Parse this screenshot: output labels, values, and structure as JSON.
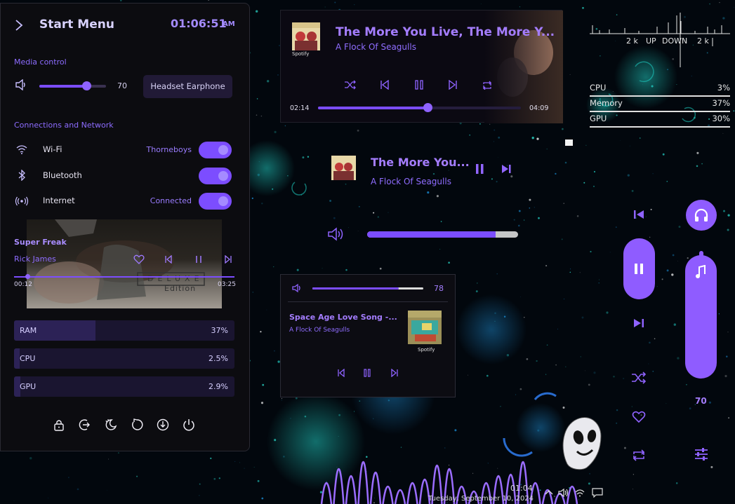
{
  "start_menu": {
    "title": "Start Menu",
    "time": "01:06:51",
    "ampm": "AM",
    "media_section": "Media control",
    "volume": "70",
    "audio_device": "Headset Earphone",
    "network_section": "Connections and Network",
    "wifi_label": "Wi-Fi",
    "wifi_value": "Thorneboys",
    "bluetooth_label": "Bluetooth",
    "internet_label": "Internet",
    "internet_value": "Connected",
    "track_title": "Super Freak",
    "track_artist": "Rick James",
    "album_label_top": "DELUXE",
    "album_label_bottom": "Edition",
    "elapsed": "00:12",
    "duration": "03:25",
    "progress": 0.06,
    "ram_label": "RAM",
    "ram_value": "37%",
    "ram_fraction": 0.37,
    "cpu_label": "CPU",
    "cpu_value": "2.5%",
    "cpu_fraction": 0.025,
    "gpu_label": "GPU",
    "gpu_value": "2.9%",
    "gpu_fraction": 0.029,
    "power_icons": [
      "lock-icon",
      "sign-out-icon",
      "sleep-icon",
      "restart-icon",
      "hibernate-icon",
      "power-icon"
    ]
  },
  "player_large": {
    "title": "The More You Live, The More Y...",
    "artist": "A Flock Of Seagulls",
    "album_badge": "Spotify",
    "elapsed": "02:14",
    "duration": "04:09",
    "progress": 0.54
  },
  "player_compact": {
    "title": "The More You...",
    "artist": "A Flock Of Seagulls",
    "volume_fraction": 0.85
  },
  "player_small": {
    "volume": "78",
    "volume_fraction": 0.78,
    "title": "Space Age Love Song -...",
    "artist": "A Flock Of Seagulls",
    "album_badge": "Spotify"
  },
  "netmon": {
    "up_value": "2 k",
    "up_label": "UP",
    "down_label": "DOWN",
    "down_value": "2 k"
  },
  "sysmon": {
    "rows": [
      {
        "label": "CPU",
        "value": "3%"
      },
      {
        "label": "Memory",
        "value": "37%"
      },
      {
        "label": "GPU",
        "value": "30%"
      }
    ]
  },
  "side_player": {
    "volume": "70",
    "volume_fraction": 0.7
  },
  "taskbar": {
    "time": "01:04",
    "date": "Tuesday, September 10, 2024"
  },
  "colors": {
    "accent": "#7c4dff",
    "accent_light": "#a47dff",
    "panel": "#0c0c10"
  }
}
